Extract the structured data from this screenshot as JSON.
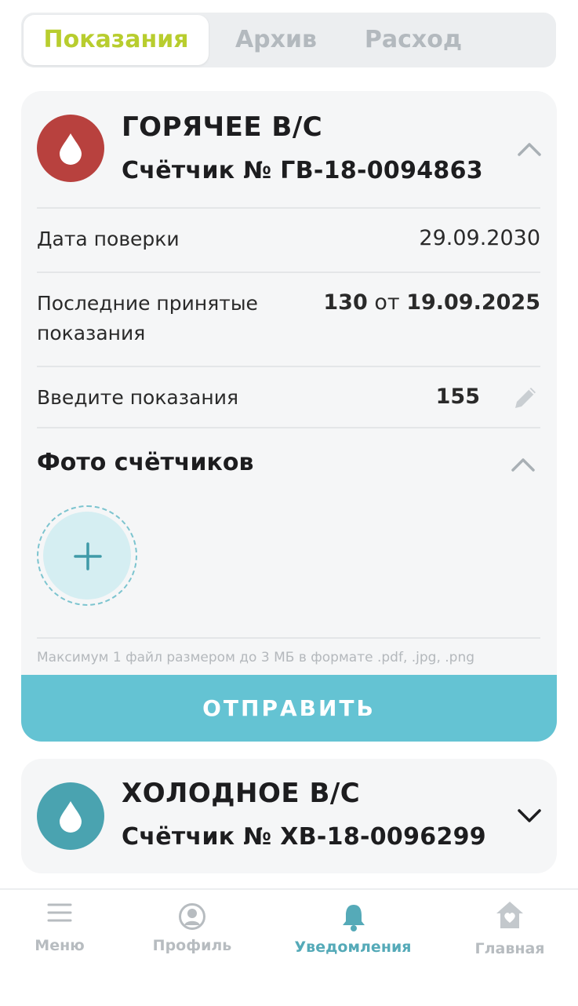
{
  "tabs": [
    {
      "label": "Показания",
      "active": true
    },
    {
      "label": "Архив",
      "active": false
    },
    {
      "label": "Расход",
      "active": false
    }
  ],
  "hot_meter": {
    "title": "ГОРЯЧЕЕ В/С",
    "number": "Счётчик № ГВ-18-0094863",
    "icon_color": "#b8413e",
    "verification_label": "Дата поверки",
    "verification_date": "29.09.2030",
    "last_label_line1": "Последние принятые",
    "last_label_line2": "показания",
    "last_value": "130",
    "last_from": "от",
    "last_date": "19.09.2025",
    "enter_label": "Введите показания",
    "enter_value": "155",
    "photos_title": "Фото счётчиков",
    "hint": "Максимум 1 файл размером до 3 МБ в формате .pdf, .jpg, .png",
    "send_label": "ОТПРАВИТЬ"
  },
  "cold_meter": {
    "title": "ХОЛОДНОЕ В/С",
    "number": "Счётчик № ХВ-18-0096299",
    "icon_color": "#4aa3b0"
  },
  "nav": [
    {
      "label": "Меню",
      "icon": "menu-icon",
      "active": false
    },
    {
      "label": "Профиль",
      "icon": "profile-icon",
      "active": false
    },
    {
      "label": "Уведомления",
      "icon": "bell-icon",
      "active": true
    },
    {
      "label": "Главная",
      "icon": "home-icon",
      "active": false
    }
  ],
  "colors": {
    "accent": "#64c3d3",
    "tab_active": "#b8cd2e",
    "nav_active": "#55aab8"
  }
}
